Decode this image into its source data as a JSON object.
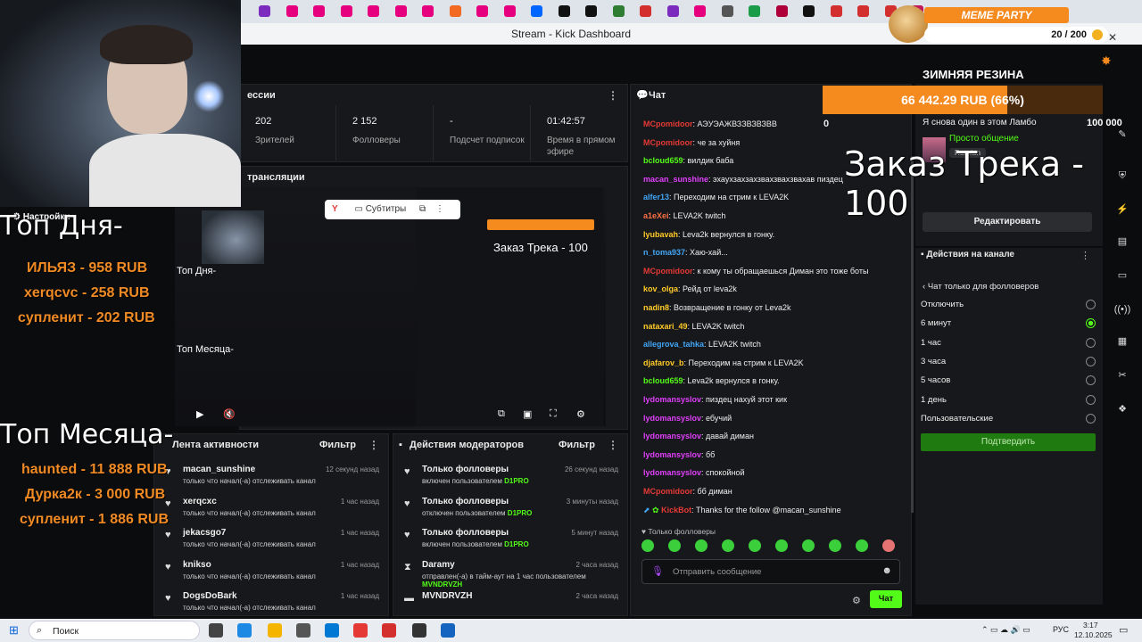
{
  "browser": {
    "window_title": "Stream - Kick Dashboard",
    "tab_colors": [
      "#7b2cbf",
      "#e6007e",
      "#e6007e",
      "#e6007e",
      "#e6007e",
      "#e6007e",
      "#e6007e",
      "#f26a21",
      "#e6007e",
      "#e6007e",
      "#0066ff",
      "#111111",
      "#111111",
      "#2e7d32",
      "#d32f2f",
      "#7b2cbf",
      "#e6007e",
      "#555555",
      "#1a9c49",
      "#b0003a",
      "#111111",
      "#d32f2f",
      "#d32f2f",
      "#d32f2f",
      "#c2185b"
    ]
  },
  "meme": {
    "title": "MEME PARTY",
    "counter": "20 / 200"
  },
  "goal": {
    "title": "ЗИМНЯЯ РЕЗИНА",
    "progress_label": "66 442.29 RUB (66%)",
    "progress": 0.66
  },
  "overlay": {
    "order_text": "Заказ Трека - 100",
    "top_day_title": "Топ Дня-",
    "top_day": [
      "ИЛЬЯЗ - 958 RUB",
      "xerqcvc - 258 RUB",
      "супленит - 202 RUB"
    ],
    "top_month_title": "Топ Месяца-",
    "top_month": [
      "haunted - 11 888 RUB",
      "Дурка2к - 3 000 RUB",
      "супленит - 1 886 RUB"
    ],
    "settings_label": "Настройки"
  },
  "session": {
    "title": "ессии",
    "stats": [
      {
        "value": "202",
        "label": "Зрителей"
      },
      {
        "value": "2 152",
        "label": "Фолловеры"
      },
      {
        "value": "-",
        "label": "Подсчет подписок"
      },
      {
        "value": "01:42:57",
        "label": "Время в прямом эфире"
      }
    ]
  },
  "broadcast": {
    "title": "трансляции",
    "subtitles_label": "Субтитры"
  },
  "activity": {
    "title": "Лента активности",
    "filter_label": "Фильтр",
    "items": [
      {
        "name": "macan_sunshine",
        "time": "12 секунд назад",
        "sub": "только что начал(-а) отслеживать канал"
      },
      {
        "name": "xerqcxc",
        "time": "1 час назад",
        "sub": "только что начал(-а) отслеживать канал"
      },
      {
        "name": "jekacsgo7",
        "time": "1 час назад",
        "sub": "только что начал(-а) отслеживать канал"
      },
      {
        "name": "knikso",
        "time": "1 час назад",
        "sub": "только что начал(-а) отслеживать канал"
      },
      {
        "name": "DogsDoBark",
        "time": "1 час назад",
        "sub": "только что начал(-а) отслеживать канал"
      }
    ]
  },
  "modactions": {
    "title": "Действия модераторов",
    "filter_label": "Фильтр",
    "items": [
      {
        "name": "Только фолловеры",
        "time": "26 секунд назад",
        "sub": "включен пользователем",
        "who": "D1PRO"
      },
      {
        "name": "Только фолловеры",
        "time": "3 минуты назад",
        "sub": "отключен пользователем",
        "who": "D1PRO"
      },
      {
        "name": "Только фолловеры",
        "time": "5 минут назад",
        "sub": "включен пользователем",
        "who": "D1PRO"
      },
      {
        "name": "Daramy",
        "time": "2 часа назад",
        "sub": "отправлен(-а) в тайм-аут на 1 час пользователем",
        "who": "MVNDRVZH"
      },
      {
        "name": "MVNDRVZH",
        "time": "2 часа назад",
        "sub": "",
        "who": ""
      }
    ]
  },
  "chat": {
    "title": "Чат",
    "count": "0",
    "messages": [
      {
        "user": "MCpomidoor",
        "color": "#e53935",
        "text": ": АЭУЭАЖВЗЗВЗВЗВВ"
      },
      {
        "user": "MCpomidoor",
        "color": "#e53935",
        "text": ": че за хуйня"
      },
      {
        "user": "bcloud659",
        "color": "#53fc18",
        "text": ": вилдик баба"
      },
      {
        "user": "macan_sunshine",
        "color": "#e040fb",
        "text": ": эхаухзахзахзвахзвахзвахав пиздец"
      },
      {
        "user": "alfer13",
        "color": "#42a5f5",
        "text": ": Переходим на стрим к LEVA2K"
      },
      {
        "user": "a1eXei",
        "color": "#ff7043",
        "text": ": LEVA2K twitch"
      },
      {
        "user": "lyubavah",
        "color": "#ffca28",
        "text": ": Leva2k вернулся в гонку."
      },
      {
        "user": "n_toma937",
        "color": "#42a5f5",
        "text": ": Хаю-хай..."
      },
      {
        "user": "MCpomidoor",
        "color": "#e53935",
        "text": ": к кому ты обращаешься Диман это тоже боты"
      },
      {
        "user": "kov_olga",
        "color": "#ffca28",
        "text": ": Рейд от leva2k"
      },
      {
        "user": "nadin8",
        "color": "#ffca28",
        "text": ": Возвращение в гонку от Leva2k"
      },
      {
        "user": "nataxari_49",
        "color": "#ffca28",
        "text": ": LEVA2K twitch"
      },
      {
        "user": "allegrova_tahka",
        "color": "#42a5f5",
        "text": ": LEVA2K twitch"
      },
      {
        "user": "djafarov_b",
        "color": "#ffca28",
        "text": ": Переходим на стрим к LEVA2K"
      },
      {
        "user": "bcloud659",
        "color": "#53fc18",
        "text": ": Leva2k вернулся в гонку."
      },
      {
        "user": "lydomansyslov",
        "color": "#e040fb",
        "text": ": пиздец нахуй этот кик"
      },
      {
        "user": "lydomansyslov",
        "color": "#e040fb",
        "text": ": ебучий"
      },
      {
        "user": "lydomansyslov",
        "color": "#e040fb",
        "text": ": давай диман"
      },
      {
        "user": "lydomansyslov",
        "color": "#e040fb",
        "text": ": бб"
      },
      {
        "user": "lydomansyslov",
        "color": "#e040fb",
        "text": ": спокойной"
      },
      {
        "user": "MCpomidoor",
        "color": "#e53935",
        "text": ": бб диман"
      },
      {
        "user": "KickBot",
        "color": "#e53935",
        "text": ": Thanks for the follow @macan_sunshine"
      }
    ],
    "followers_only": "Только фолловеры",
    "input_placeholder": "Отправить сообщение",
    "send_label": "Чат"
  },
  "right": {
    "tts_text": "Я снова один в этом Ламбо",
    "tts_amount": "100 000",
    "category": "Просто общение",
    "language": "Russian",
    "edit_label": "Редактировать",
    "actions_title": "Действия на канале",
    "followers_mode_title": "Чат только для фолловеров",
    "options": [
      "Отключить",
      "6 минут",
      "1 час",
      "3 часа",
      "5 часов",
      "1 день",
      "Пользовательские"
    ],
    "selected_index": 1,
    "confirm_label": "Подтвердить"
  },
  "taskbar": {
    "search_label": "Поиск",
    "lang": "РУС",
    "time": "3:17",
    "date": "12.10.2025"
  }
}
